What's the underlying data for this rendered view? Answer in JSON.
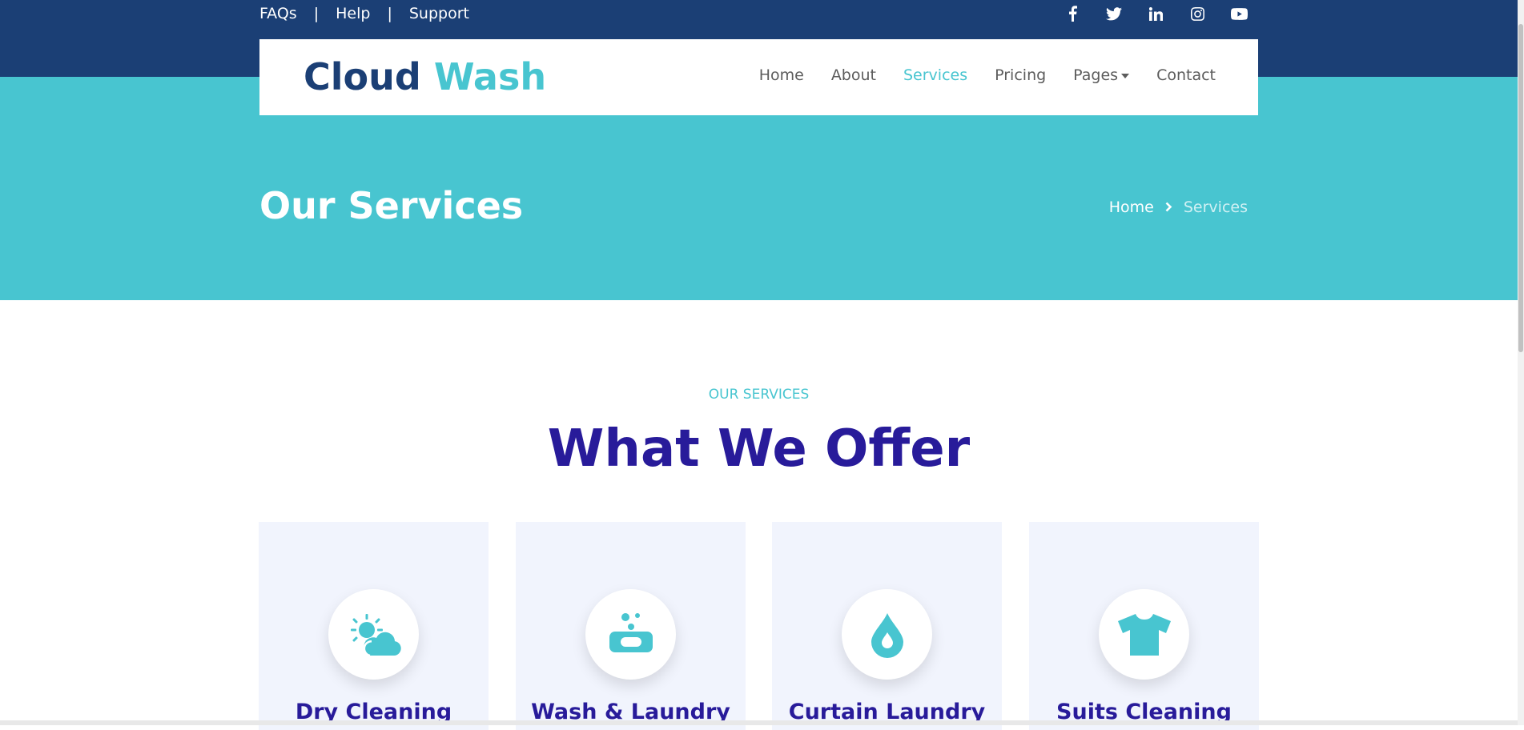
{
  "topbar": {
    "links": [
      "FAQs",
      "Help",
      "Support"
    ],
    "separator": "|",
    "social_icons": [
      "facebook-icon",
      "twitter-icon",
      "linkedin-icon",
      "instagram-icon",
      "youtube-icon"
    ]
  },
  "brand": {
    "part1": "Cloud",
    "part2": "Wash"
  },
  "nav": {
    "items": [
      "Home",
      "About",
      "Services",
      "Pricing",
      "Pages",
      "Contact"
    ],
    "active": "Services"
  },
  "hero": {
    "title": "Our Services",
    "breadcrumb": {
      "home": "Home",
      "current": "Services"
    }
  },
  "section": {
    "label": "OUR SERVICES",
    "heading": "What We Offer"
  },
  "services": [
    {
      "title": "Dry Cleaning",
      "icon": "sun-cloud-icon"
    },
    {
      "title": "Wash & Laundry",
      "icon": "soap-icon"
    },
    {
      "title": "Curtain Laundry",
      "icon": "water-drop-icon"
    },
    {
      "title": "Suits Cleaning",
      "icon": "tshirt-icon"
    }
  ],
  "colors": {
    "navy": "#1b3f75",
    "teal": "#48c5d0",
    "heading_purple": "#281b9a",
    "card_bg": "#f1f4fd"
  }
}
